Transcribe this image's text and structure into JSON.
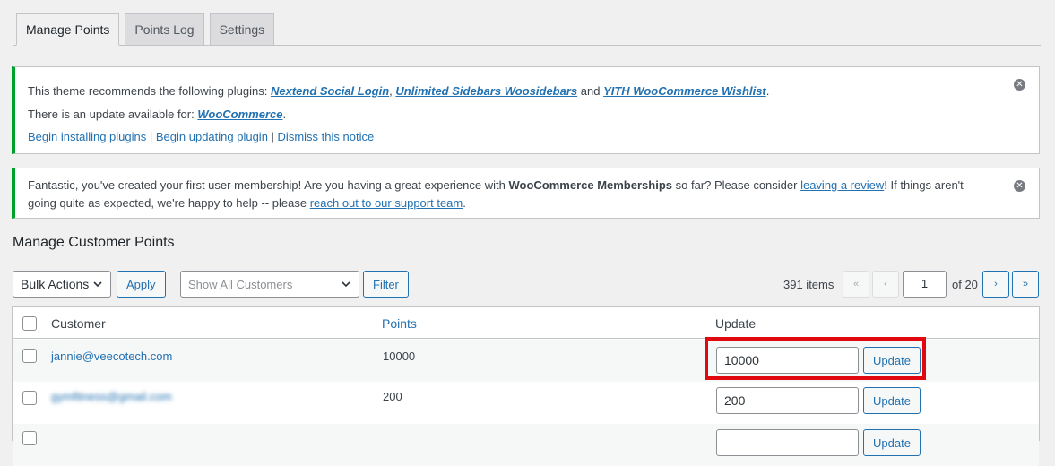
{
  "tabs": [
    {
      "label": "Manage Points",
      "active": true
    },
    {
      "label": "Points Log",
      "active": false
    },
    {
      "label": "Settings",
      "active": false
    }
  ],
  "notice1": {
    "line1_prefix": "This theme recommends the following plugins: ",
    "plugin1": "Nextend Social Login",
    "sep1": ", ",
    "plugin2": "Unlimited Sidebars Woosidebars",
    "and": " and ",
    "plugin3": "YITH WooCommerce Wishlist",
    "period": ".",
    "line2_prefix": "There is an update available for: ",
    "update_plugin": "WooCommerce",
    "link_install": "Begin installing plugins",
    "link_update": "Begin updating plugin",
    "link_dismiss": "Dismiss this notice",
    "pipe": " | "
  },
  "notice2": {
    "text1": "Fantastic, you've created your first user membership! Are you having a great experience with ",
    "strong": "WooCommerce Memberships",
    "text2": " so far? Please consider ",
    "link_review": "leaving a review",
    "text3": "! If things aren't going quite as expected, we're happy to help -- please ",
    "link_support": "reach out to our support team",
    "text4": "."
  },
  "heading": "Manage Customer Points",
  "toolbar": {
    "bulk_actions": "Bulk Actions",
    "apply": "Apply",
    "customer_filter": "Show All Customers",
    "filter": "Filter",
    "items_count": "391 items",
    "first": "«",
    "prev": "‹",
    "page": "1",
    "of_pages": "of 20",
    "next": "›",
    "last": "»"
  },
  "table": {
    "headers": {
      "customer": "Customer",
      "points": "Points",
      "update": "Update"
    },
    "rows": [
      {
        "customer": "jannie@veecotech.com",
        "points": "10000",
        "input": "10000",
        "button": "Update"
      },
      {
        "customer": "gymfitness@gmail.com",
        "points": "200",
        "input": "200",
        "button": "Update"
      },
      {
        "customer": "",
        "points": "",
        "input": "",
        "button": "Update"
      }
    ]
  },
  "colors": {
    "accent": "#2271b1",
    "notice_border": "#00a32a",
    "highlight": "#e0090f"
  }
}
